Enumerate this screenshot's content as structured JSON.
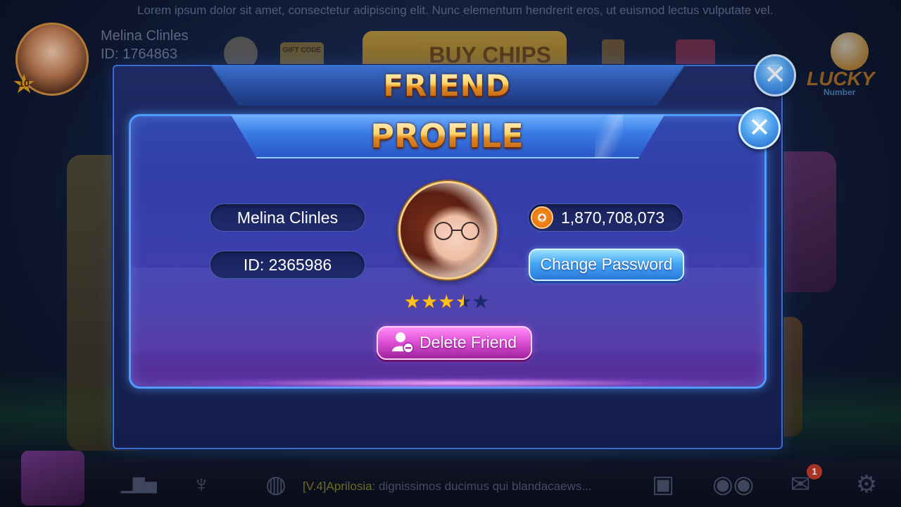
{
  "background": {
    "ticker": "Lorem ipsum dolor sit amet, consectetur adipiscing elit. Nunc elementum hendrerit eros, ut euismod lectus vulputate vel.",
    "player": {
      "name": "Melina Clinles",
      "id": "ID: 1764863",
      "level": "10"
    },
    "buy_chips_label": "BUY CHIPS",
    "gift_code_label": "GIFT CODE",
    "lucky_number": {
      "word": "LUCKY",
      "sub": "Number"
    },
    "bottom_bar": {
      "chat_tag": "[V.4]Aprilosia",
      "chat_text": ": dignissimos ducimus qui blandacaews...",
      "mail_badge": "1"
    }
  },
  "friend_dialog": {
    "title": "FRIEND",
    "close_symbol": "✕"
  },
  "profile_dialog": {
    "title": "PROFILE",
    "close_symbol": "✕",
    "name": "Melina Clinles",
    "id": "ID: 2365986",
    "chips": "1,870,708,073",
    "rating": 3.5,
    "rating_max": 5,
    "change_password_label": "Change Password",
    "delete_friend_label": "Delete Friend"
  },
  "colors": {
    "panel_border": "#4f9bff",
    "title_gold": "#ffd36b",
    "star": "#ffc21a",
    "delete_button": "#e052d8",
    "change_password_button": "#44a8f4"
  }
}
